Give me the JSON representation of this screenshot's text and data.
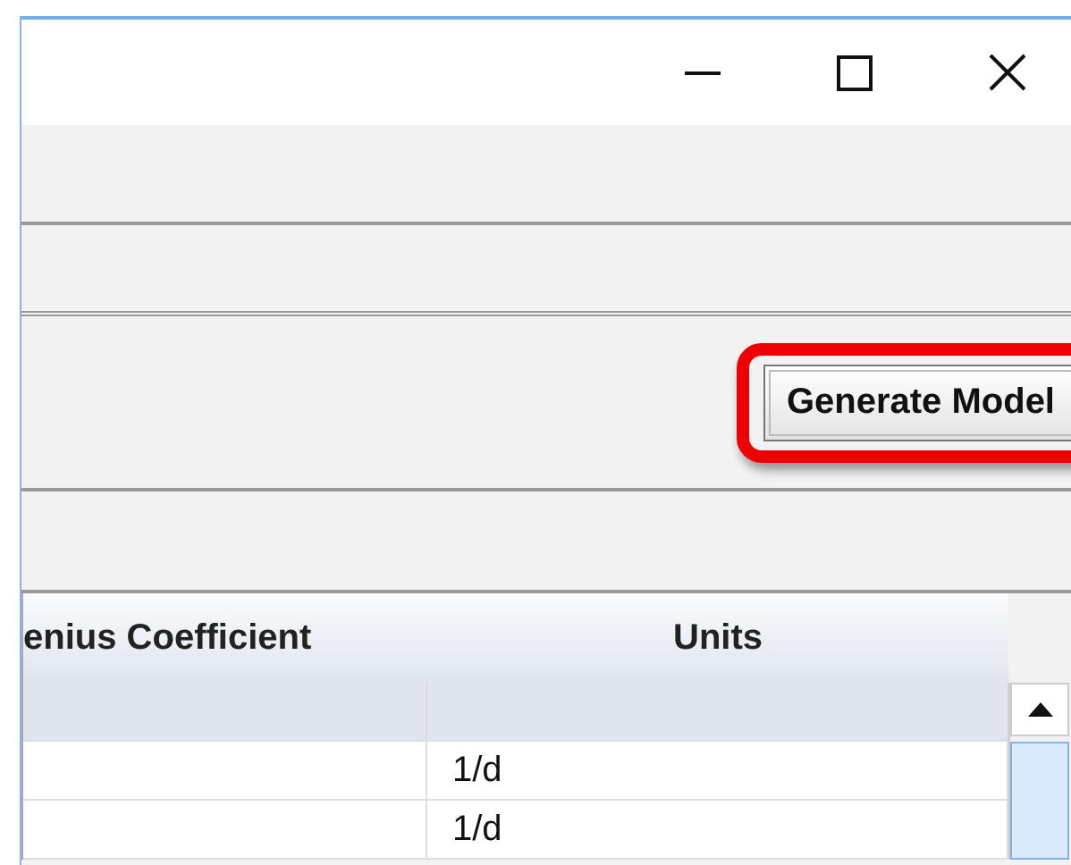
{
  "window": {
    "controls": [
      {
        "kind": "minimize"
      },
      {
        "kind": "maximize"
      },
      {
        "kind": "close"
      }
    ]
  },
  "button": {
    "label": "Generate Model",
    "highlighted": true
  },
  "table": {
    "columns": [
      "enius Coefficient",
      "Units"
    ],
    "rows": [
      {
        "selected": true
      },
      {
        "units": "1/d",
        "selected": false
      },
      {
        "units": "1/d",
        "selected": false
      }
    ]
  }
}
